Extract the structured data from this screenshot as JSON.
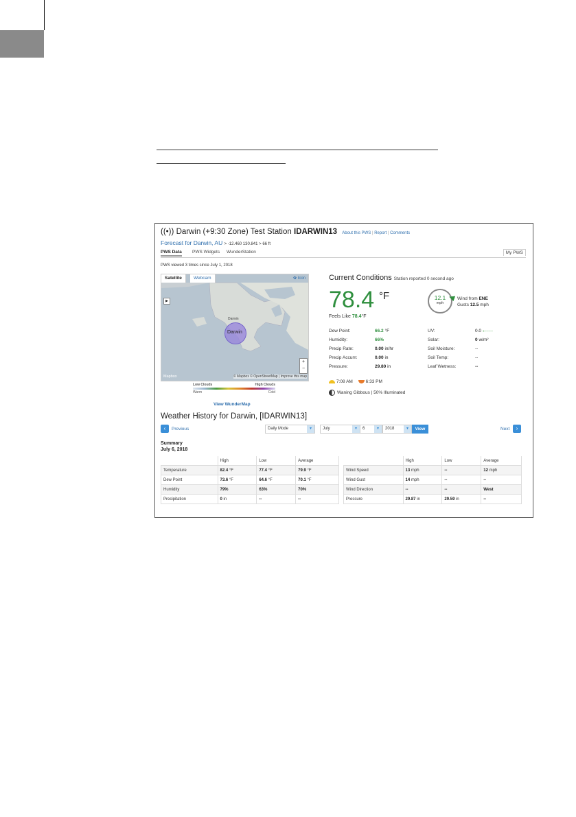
{
  "header": {
    "station_name": "Darwin (+9:30 Zone) Test Station",
    "station_id": "IDARWIN13",
    "links": [
      "About this PWS",
      "Report",
      "Comments"
    ],
    "forecast_link": "Forecast for Darwin, AU",
    "coords": "> -12.460 130.841 > 66 ft"
  },
  "tabs": [
    "PWS Data",
    "PWS Widgets",
    "WunderStation"
  ],
  "my_pws": "My PWS",
  "viewed_text": "PWS viewed 3 times since July 1, 2018",
  "map": {
    "tabs": [
      "Satellite",
      "Webcam"
    ],
    "icon_link": "Icon",
    "marker": "Darwin",
    "labels": [
      "Darwin"
    ],
    "attribution_left": "Mapbox",
    "attribution_right": "© Mapbox © OpenStreetMap | Improve this map",
    "legend_low": "Low Clouds",
    "legend_high": "High Clouds",
    "legend_warm": "Warm",
    "legend_cold": "Cold",
    "view_link": "View WunderMap"
  },
  "current": {
    "title": "Current Conditions",
    "reported": "Station reported 0 second ago",
    "temp": "78.4",
    "unit": "°F",
    "feels_label": "Feels Like",
    "feels_value": "78.4",
    "feels_unit": "°F",
    "wind_speed": "12.1",
    "wind_unit": "mph",
    "wind_from_label": "Wind from",
    "wind_dir": "ENE",
    "gusts_label": "Gusts",
    "gusts_value": "12.5",
    "gusts_unit": "mph",
    "left_stats": [
      {
        "label": "Dew Point:",
        "value": "66.2",
        "unit": "°F",
        "green": true
      },
      {
        "label": "Humidity:",
        "value": "66%",
        "unit": "",
        "green": true
      },
      {
        "label": "Precip Rate:",
        "value": "0.00",
        "unit": "in/hr",
        "green": false
      },
      {
        "label": "Precip Accum:",
        "value": "0.00",
        "unit": "in",
        "green": false
      },
      {
        "label": "Pressure:",
        "value": "29.80",
        "unit": "in",
        "green": false
      }
    ],
    "right_stats": [
      {
        "label": "UV:",
        "value": "0.0",
        "unit": ""
      },
      {
        "label": "Solar:",
        "value": "0",
        "unit": "w/m²"
      },
      {
        "label": "Soil Moisture:",
        "value": "--",
        "unit": ""
      },
      {
        "label": "Soil Temp:",
        "value": "--",
        "unit": ""
      },
      {
        "label": "Leaf Wetness:",
        "value": "--",
        "unit": ""
      }
    ],
    "sunrise": "7:08 AM",
    "sunset": "6:33 PM",
    "moon": "Waning Gibbous | 50% Illuminated"
  },
  "history": {
    "title": "Weather History for Darwin, [IDARWIN13]",
    "previous": "Previous",
    "next": "Next",
    "mode": "Daily Mode",
    "month": "July",
    "day": "6",
    "year": "2018",
    "view_button": "View",
    "summary_label": "Summary",
    "summary_date": "July 6, 2018",
    "columns": [
      "High",
      "Low",
      "Average"
    ],
    "left_rows": [
      {
        "label": "Temperature",
        "high": "82.4",
        "high_u": "°F",
        "low": "77.4",
        "low_u": "°F",
        "avg": "79.9",
        "avg_u": "°F"
      },
      {
        "label": "Dew Point",
        "high": "73.6",
        "high_u": "°F",
        "low": "64.6",
        "low_u": "°F",
        "avg": "70.1",
        "avg_u": "°F"
      },
      {
        "label": "Humidity",
        "high": "79%",
        "high_u": "",
        "low": "63%",
        "low_u": "",
        "avg": "70%",
        "avg_u": ""
      },
      {
        "label": "Precipitation",
        "high": "0",
        "high_u": "in",
        "low": "--",
        "low_u": "",
        "avg": "--",
        "avg_u": ""
      }
    ],
    "right_rows": [
      {
        "label": "Wind Speed",
        "high": "13",
        "high_u": "mph",
        "low": "--",
        "low_u": "",
        "avg": "12",
        "avg_u": "mph"
      },
      {
        "label": "Wind Gust",
        "high": "14",
        "high_u": "mph",
        "low": "--",
        "low_u": "",
        "avg": "--",
        "avg_u": ""
      },
      {
        "label": "Wind Direction",
        "high": "--",
        "high_u": "",
        "low": "--",
        "low_u": "",
        "avg": "West",
        "avg_u": ""
      },
      {
        "label": "Pressure",
        "high": "29.87",
        "high_u": "in",
        "low": "29.59",
        "low_u": "in",
        "avg": "--",
        "avg_u": ""
      }
    ]
  }
}
